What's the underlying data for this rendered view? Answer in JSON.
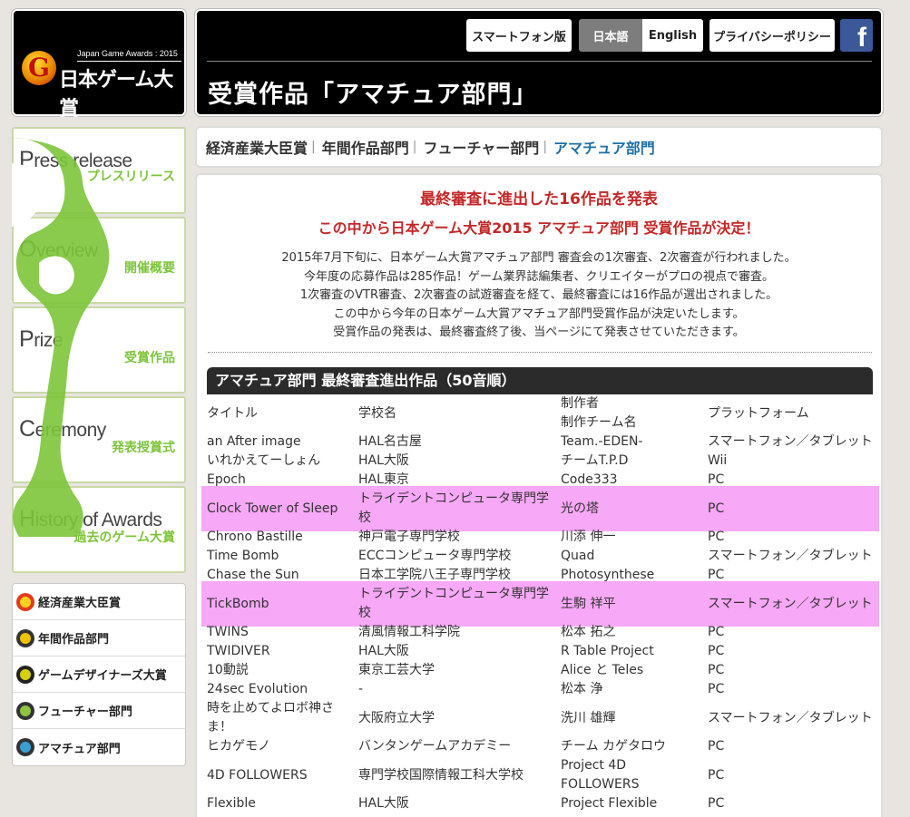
{
  "logo": {
    "mark": "G",
    "subtitle": "Japan Game Awards : 2015",
    "title": "日本ゲーム大賞"
  },
  "header": {
    "buttons": {
      "smartphone": "スマートフォン版",
      "japanese": "日本語",
      "english": "English",
      "privacy": "プライバシーポリシー"
    },
    "facebook_glyph": "f",
    "page_title": "受賞作品「アマチュア部門」"
  },
  "nav_tiles": [
    {
      "initial": "P",
      "rest": "ress release",
      "ja": "プレスリリース"
    },
    {
      "initial": "O",
      "rest": "verview",
      "ja": "開催概要"
    },
    {
      "initial": "P",
      "rest": "rize",
      "ja": "受賞作品"
    },
    {
      "initial": "C",
      "rest": "eremony",
      "ja": "発表授賞式"
    },
    {
      "initial": "H",
      "rest": "istory of Awards",
      "ja": "過去のゲーム大賞"
    }
  ],
  "categories": [
    {
      "label": "経済産業大臣賞",
      "color": "#d43a1e"
    },
    {
      "label": "年間作品部門",
      "color": "#e8b400"
    },
    {
      "label": "ゲームデザイナーズ大賞",
      "color": "#c9c400"
    },
    {
      "label": "フューチャー部門",
      "color": "#8cc63f"
    },
    {
      "label": "アマチュア部門",
      "color": "#3aa0d4"
    }
  ],
  "tabs": [
    {
      "label": "経済産業大臣賞"
    },
    {
      "label": "年間作品部門"
    },
    {
      "label": "フューチャー部門"
    },
    {
      "label": "アマチュア部門"
    }
  ],
  "tab_separator": "|",
  "main": {
    "headline1": "最終審査に進出した16作品を発表",
    "headline2": "この中から日本ゲーム大賞2015 アマチュア部門 受賞作品が決定！",
    "intro": [
      "2015年7月下旬に、日本ゲーム大賞アマチュア部門 審査会の1次審査、2次審査が行われました。",
      "今年度の応募作品は285作品！ゲーム業界誌編集者、クリエイターがプロの視点で審査。",
      "1次審査のVTR審査、2次審査の試遊審査を経て、最終審査には16作品が選出されました。",
      "この中から今年の日本ゲーム大賞アマチュア部門受賞作品が決定いたします。",
      "受賞作品の発表は、最終審査終了後、当ページにて発表させていただきます。"
    ],
    "list_title": "アマチュア部門 最終審査進出作品（50音順）"
  },
  "table": {
    "headers": [
      "タイトル",
      "学校名",
      "制作者\n制作チーム名",
      "プラットフォーム"
    ],
    "rows": [
      {
        "title": "an After image",
        "school": "HAL名古屋",
        "creator": "Team.-EDEN-",
        "platform": "スマートフォン／タブレット"
      },
      {
        "title": "いれかえてーしょん",
        "school": "HAL大阪",
        "creator": "チームT.P.D",
        "platform": "Wii"
      },
      {
        "title": "Epoch",
        "school": "HAL東京",
        "creator": "Code333",
        "platform": "PC"
      },
      {
        "title": "Clock Tower of Sleep",
        "school": "トライデントコンピュータ専門学校",
        "creator": "光の塔",
        "platform": "PC",
        "highlight": true
      },
      {
        "title": "Chrono Bastille",
        "school": "神戸電子専門学校",
        "creator": "川添 伸一",
        "platform": "PC"
      },
      {
        "title": "Time Bomb",
        "school": "ECCコンピュータ専門学校",
        "creator": "Quad",
        "platform": "スマートフォン／タブレット"
      },
      {
        "title": "Chase the Sun",
        "school": "日本工学院八王子専門学校",
        "creator": "Photosynthese",
        "platform": "PC"
      },
      {
        "title": "TickBomb",
        "school": "トライデントコンピュータ専門学校",
        "creator": "生駒 祥平",
        "platform": "スマートフォン／タブレット",
        "highlight": true
      },
      {
        "title": "TWINS",
        "school": "清風情報工科学院",
        "creator": "松本 拓之",
        "platform": "PC"
      },
      {
        "title": "TWIDIVER",
        "school": "HAL大阪",
        "creator": "R Table Project",
        "platform": "PC"
      },
      {
        "title": "10動説",
        "school": "東京工芸大学",
        "creator": "Alice と Teles",
        "platform": "PC"
      },
      {
        "title": "24sec Evolution",
        "school": "-",
        "creator": "松本 浄",
        "platform": "PC"
      },
      {
        "title": "時を止めてよロボ神さま！",
        "school": "大阪府立大学",
        "creator": "洗川 雄輝",
        "platform": "スマートフォン／タブレット"
      },
      {
        "title": "ヒカゲモノ",
        "school": "バンタンゲームアカデミー",
        "creator": "チーム カゲタロウ",
        "platform": "PC"
      },
      {
        "title": "4D FOLLOWERS",
        "school": "専門学校国際情報工科大学校",
        "creator": "Project 4D FOLLOWERS",
        "platform": "PC"
      },
      {
        "title": "Flexible",
        "school": "HAL大阪",
        "creator": "Project Flexible",
        "platform": "PC"
      }
    ]
  }
}
